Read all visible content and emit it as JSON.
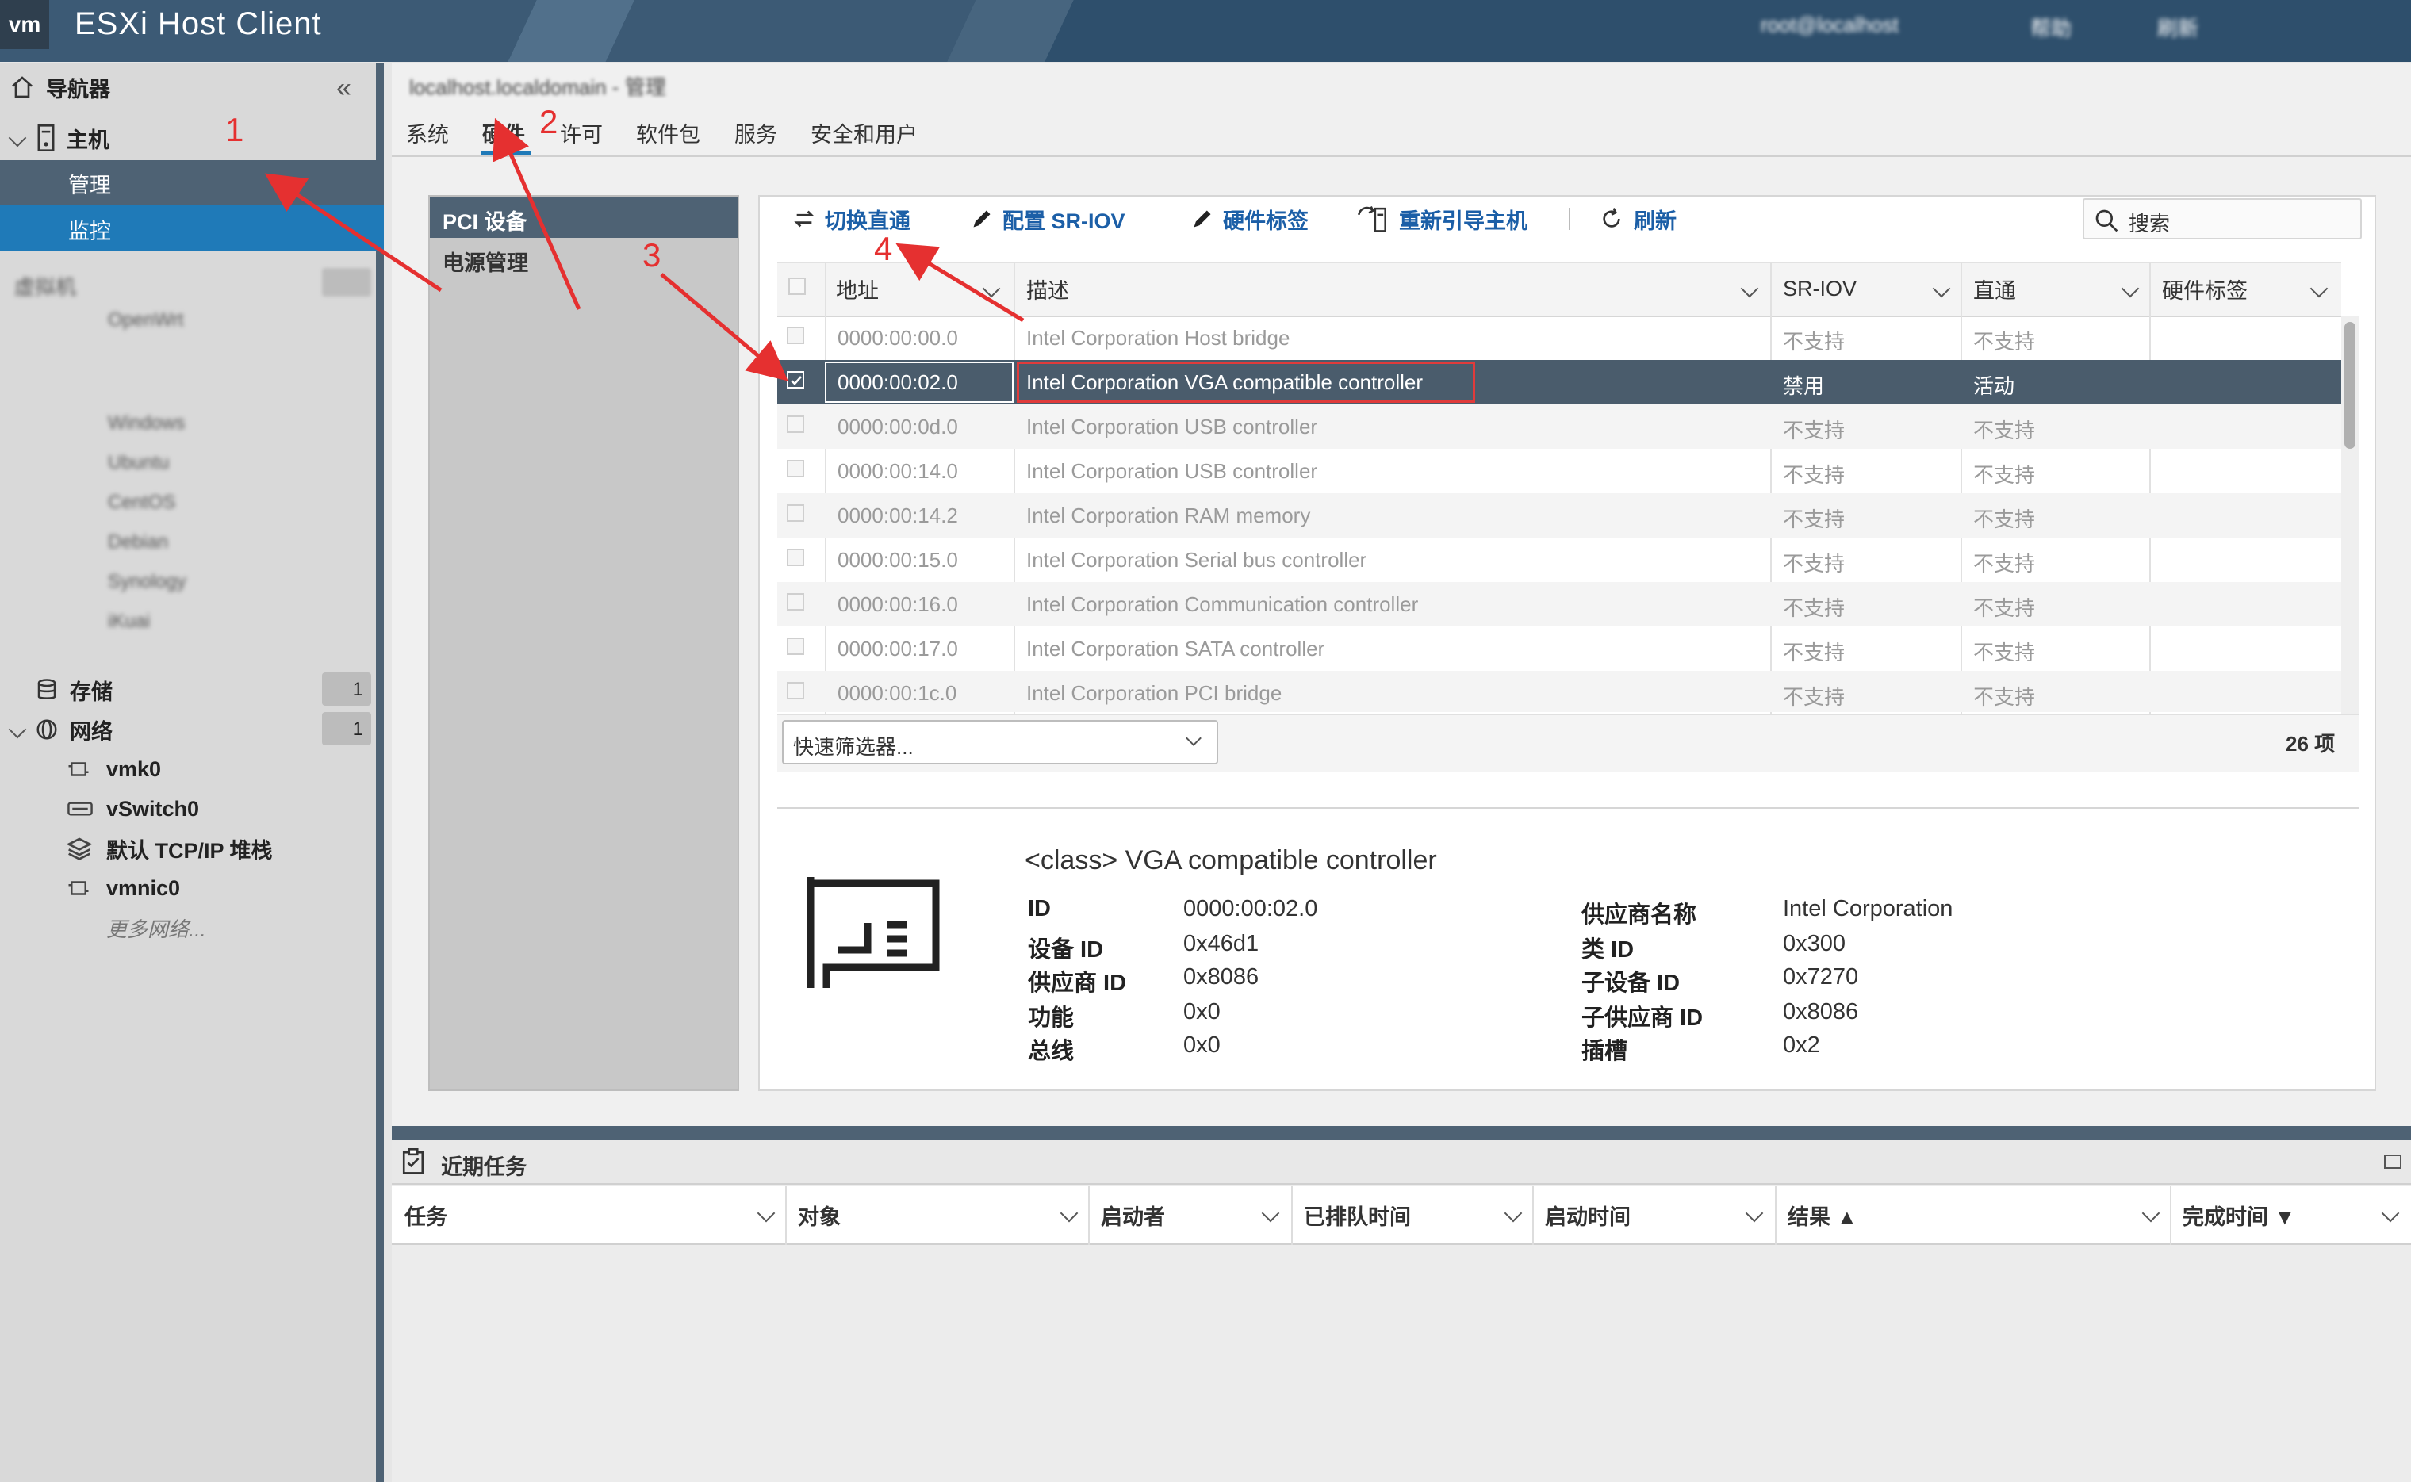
{
  "app": {
    "logo": "vm",
    "title": "ESXi Host Client",
    "user_blurred": "root@localhost",
    "host_blurred": "帮助",
    "refresh_blurred": "刷新"
  },
  "navigator": {
    "title": "导航器",
    "collapse_icon": "double-chevron-left-icon",
    "host_label": "主机",
    "host_items": [
      "管理",
      "监控"
    ],
    "vm_group_blurred": "虚拟机",
    "vm_items_blurred": [
      "OpenWrt",
      "Windows",
      "Ubuntu",
      "CentOS",
      "Debian",
      "Synology",
      "iKuai"
    ],
    "storage": {
      "label": "存储",
      "count": "1"
    },
    "network": {
      "label": "网络",
      "count": "1",
      "items": [
        {
          "label": "vmk0",
          "icon": "vmkernel-nic-icon"
        },
        {
          "label": "vSwitch0",
          "icon": "vswitch-icon"
        },
        {
          "label": "默认 TCP/IP 堆栈",
          "icon": "tcpip-stack-icon"
        },
        {
          "label": "vmnic0",
          "icon": "physical-nic-icon"
        }
      ],
      "more": "更多网络..."
    }
  },
  "breadcrumb_blurred": "localhost.localdomain - 管理",
  "tabs": [
    "系统",
    "硬件",
    "许可",
    "软件包",
    "服务",
    "安全和用户"
  ],
  "active_tab": "硬件",
  "subnav": [
    "PCI 设备",
    "电源管理"
  ],
  "toolbar": {
    "toggle_passthrough": "切换直通",
    "config_sriov": "配置 SR-IOV",
    "hw_label": "硬件标签",
    "reboot_host": "重新引导主机",
    "refresh": "刷新",
    "search_placeholder": "搜索"
  },
  "table": {
    "headers": [
      "地址",
      "描述",
      "SR-IOV",
      "直通",
      "硬件标签"
    ],
    "rows": [
      {
        "addr": "0000:00:00.0",
        "desc": "Intel Corporation Host bridge",
        "sriov": "不支持",
        "pass": "不支持"
      },
      {
        "addr": "0000:00:02.0",
        "desc": "Intel Corporation VGA compatible controller",
        "sriov": "禁用",
        "pass": "活动",
        "selected": true
      },
      {
        "addr": "0000:00:0d.0",
        "desc": "Intel Corporation USB controller",
        "sriov": "不支持",
        "pass": "不支持"
      },
      {
        "addr": "0000:00:14.0",
        "desc": "Intel Corporation USB controller",
        "sriov": "不支持",
        "pass": "不支持"
      },
      {
        "addr": "0000:00:14.2",
        "desc": "Intel Corporation RAM memory",
        "sriov": "不支持",
        "pass": "不支持"
      },
      {
        "addr": "0000:00:15.0",
        "desc": "Intel Corporation Serial bus controller",
        "sriov": "不支持",
        "pass": "不支持"
      },
      {
        "addr": "0000:00:16.0",
        "desc": "Intel Corporation Communication controller",
        "sriov": "不支持",
        "pass": "不支持"
      },
      {
        "addr": "0000:00:17.0",
        "desc": "Intel Corporation SATA controller",
        "sriov": "不支持",
        "pass": "不支持"
      },
      {
        "addr": "0000:00:1c.0",
        "desc": "Intel Corporation PCI bridge",
        "sriov": "不支持",
        "pass": "不支持"
      }
    ],
    "filter_placeholder": "快速筛选器...",
    "count": "26 项"
  },
  "details": {
    "title": "<class> VGA compatible controller",
    "left": [
      {
        "k": "ID",
        "v": "0000:00:02.0"
      },
      {
        "k": "设备 ID",
        "v": "0x46d1"
      },
      {
        "k": "供应商 ID",
        "v": "0x8086"
      },
      {
        "k": "功能",
        "v": "0x0"
      },
      {
        "k": "总线",
        "v": "0x0"
      }
    ],
    "right": [
      {
        "k": "供应商名称",
        "v": "Intel Corporation"
      },
      {
        "k": "类 ID",
        "v": "0x300"
      },
      {
        "k": "子设备 ID",
        "v": "0x7270"
      },
      {
        "k": "子供应商 ID",
        "v": "0x8086"
      },
      {
        "k": "插槽",
        "v": "0x2"
      }
    ]
  },
  "tasks": {
    "title": "近期任务",
    "headers": [
      "任务",
      "对象",
      "启动者",
      "已排队时间",
      "启动时间",
      "结果 ▲",
      "完成时间 ▼"
    ]
  },
  "annotations": [
    "1",
    "2",
    "3",
    "4"
  ],
  "colors": {
    "topbar": "#3c5a75",
    "selected_row": "#4a5c6c",
    "accent_link": "#1c5fa7",
    "annotation": "#e53030"
  }
}
